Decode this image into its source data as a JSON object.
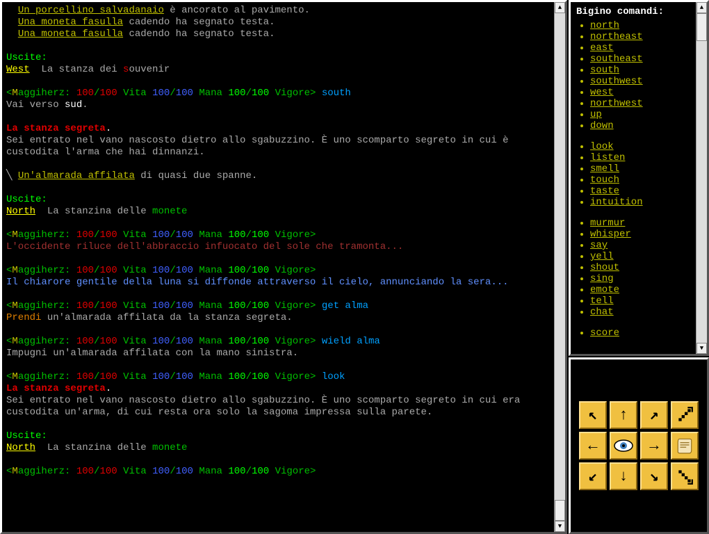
{
  "mainText": {
    "line01a": "Un porcellino salvadanaio",
    "line01b": " è ancorato al pavimento.",
    "line02a": "Una moneta fasulla",
    "line02b": " cadendo ha segnato testa.",
    "line03a": "Una moneta fasulla",
    "line03b": " cadendo ha segnato testa.",
    "exits": "Uscite:",
    "exitWest": "West",
    "westDesc1": "  La stanza dei ",
    "westDesc2": "s",
    "westDesc3": "ouvenir",
    "promptOpen": "<",
    "promptM": "M",
    "promptName": "aggiherz: ",
    "hp1": "100",
    "slash": "/",
    "hp2": "100",
    "vita": " Vita ",
    "mana1": "100",
    "mana2": "100",
    "manaLbl": " Mana ",
    "vig1": "100",
    "vig2": "100",
    "vigLbl": " Vigore",
    "promptClose": ">",
    "cmdSouth": " south",
    "southResp1": "Vai verso ",
    "southResp2": "sud",
    "southResp3": ".",
    "roomTitle": "La stanza segreta",
    "dot": ".",
    "roomDesc1": "Sei entrato nel vano nascosto dietro allo sgabuzzino. È uno scomparto segreto in cui è custodita l'arma che hai dinnanzi.",
    "itemIcon": "╲ ",
    "itemName": "Un'almarada affilata",
    "itemDesc": " di quasi due spanne.",
    "exitNorth": "North",
    "northDesc1": "  La stanzina delle ",
    "northDesc2": "monete",
    "sunset": "L'occidente riluce dell'abbraccio infuocato del sole che tramonta...",
    "moonrise": "Il chiarore gentile della luna si diffonde attraverso il cielo, annunciando la sera...",
    "cmdGet": " get alma",
    "getResp1": "Prendi",
    "getResp2": " un'almarada affilata da la stanza segreta.",
    "cmdWield": " wield alma",
    "wieldResp": "Impugni un'almarada affilata con la mano sinistra.",
    "cmdLook": " look",
    "roomDesc2": "Sei entrato nel vano nascosto dietro allo sgabuzzino. È uno scomparto segreto in cui era custodita un'arma, di cui resta ora solo la sagoma impressa sulla parete."
  },
  "commands": {
    "title": "Bigino comandi:",
    "groups": [
      [
        "north",
        "northeast",
        "east",
        "southeast",
        "south",
        "southwest",
        "west",
        "northwest",
        "up",
        "down"
      ],
      [
        "look",
        "listen",
        "smell",
        "touch",
        "taste",
        "intuition"
      ],
      [
        "murmur",
        "whisper",
        "say",
        "yell",
        "shout",
        "sing",
        "emote",
        "tell",
        "chat"
      ],
      [
        "score"
      ]
    ]
  },
  "nav": {
    "nw": "↖",
    "n": "↑",
    "ne": "↗",
    "up": "⬚",
    "w": "←",
    "look": "👁",
    "e": "→",
    "map": "📜",
    "sw": "↙",
    "s": "↓",
    "se": "↘",
    "down": "⬚"
  }
}
